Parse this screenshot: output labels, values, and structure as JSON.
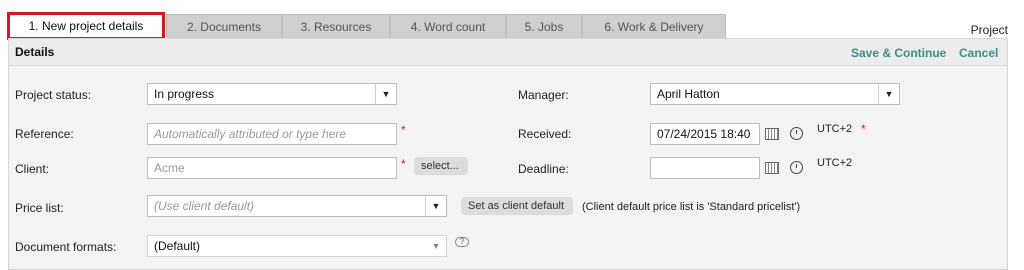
{
  "tabs": [
    {
      "label": "1. New project details",
      "active": true
    },
    {
      "label": "2. Documents"
    },
    {
      "label": "3. Resources"
    },
    {
      "label": "4. Word count"
    },
    {
      "label": "5. Jobs"
    },
    {
      "label": "6. Work & Delivery"
    }
  ],
  "header_right": "Project",
  "section": {
    "title": "Details",
    "save_label": "Save & Continue",
    "cancel_label": "Cancel"
  },
  "form": {
    "project_status": {
      "label": "Project status:",
      "value": "In progress"
    },
    "reference": {
      "label": "Reference:",
      "placeholder": "Automatically attributed or type here"
    },
    "client": {
      "label": "Client:",
      "placeholder": "Acme",
      "select_label": "select..."
    },
    "price_list": {
      "label": "Price list:",
      "placeholder": "(Use client default)",
      "set_default_label": "Set as client default",
      "note": "(Client default price list is 'Standard pricelist')"
    },
    "document_formats": {
      "label": "Document formats:",
      "value": "(Default)"
    },
    "manager": {
      "label": "Manager:",
      "value": "April Hatton"
    },
    "received": {
      "label": "Received:",
      "value": "07/24/2015 18:40",
      "tz": "UTC+2"
    },
    "deadline": {
      "label": "Deadline:",
      "value": "",
      "tz": "UTC+2"
    }
  },
  "required_marker": "*",
  "colors": {
    "accent": "#3a8f8a",
    "required": "#e0141e",
    "active_tab_border": "#e0141e"
  }
}
